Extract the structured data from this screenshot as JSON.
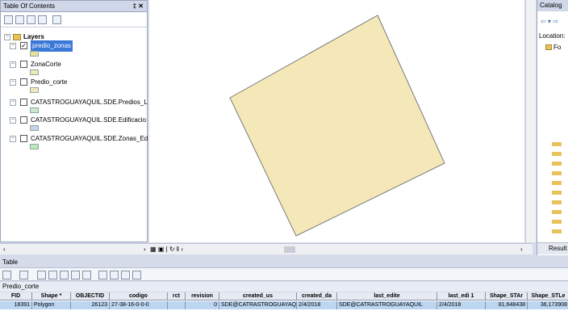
{
  "toc": {
    "title": "Table Of Contents",
    "controls": "‡ ✕",
    "layers_root": "Layers",
    "layers": [
      {
        "name": "predio_zonas",
        "checked": true,
        "selected": true,
        "color": "#e6e0a8"
      },
      {
        "name": "ZonaCorte",
        "checked": false,
        "selected": false,
        "color": "#f0e8b8"
      },
      {
        "name": "Predio_corte",
        "checked": false,
        "selected": false,
        "color": "#f2e6c0"
      },
      {
        "name": "CATASTROGUAYAQUIL.SDE.Predios_L",
        "checked": false,
        "selected": false,
        "color": "#cfe8c8"
      },
      {
        "name": "CATASTROGUAYAQUIL.SDE.Edificacio",
        "checked": false,
        "selected": false,
        "color": "#cdd0ec"
      },
      {
        "name": "CATASTROGUAYAQUIL.SDE.Zonas_Ed",
        "checked": false,
        "selected": false,
        "color": "#bfe8bf"
      }
    ]
  },
  "map": {
    "polygon_color": "#f5e8b8",
    "polygon_stroke": "#7a7a7a"
  },
  "status_bar": {
    "view_controls": "▦ ▣ | ↻ ‖  ‹",
    "right_arrow": "›",
    "left_arrow": "‹"
  },
  "catalog": {
    "title": "Catalog",
    "location_label": "Location:",
    "folder_label": "Fo",
    "results_label": "Result"
  },
  "table": {
    "title": "Table",
    "layer_name": "Predio_corte",
    "columns": [
      "FID",
      "Shape *",
      "OBJECTID",
      "codigo",
      "rct",
      "revision",
      "created_us",
      "created_da",
      "last_edite",
      "last_edi 1",
      "Shape_STAr",
      "Shape_STLe"
    ],
    "rows": [
      [
        "18391",
        "Polygon",
        "26123",
        "27-38-16-0-0-0",
        "",
        "0",
        "SDE@CATRASTROGUAYAQUI",
        "2/4/2018",
        "SDE@CATRASTROGUAYAQUIL",
        "2/4/2018",
        "81,648438",
        "36,173908"
      ]
    ]
  }
}
